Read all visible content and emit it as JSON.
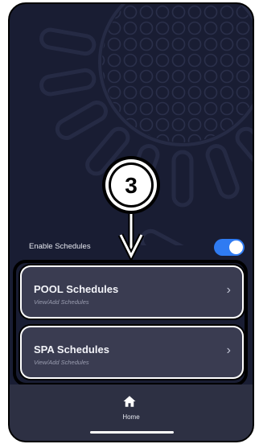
{
  "colors": {
    "background": "#191d33",
    "card": "#3a3c51",
    "bottom_bar": "#2d3043",
    "toggle_on": "#2f7bf2"
  },
  "enable_schedules": {
    "label": "Enable Schedules",
    "enabled": true
  },
  "schedules": [
    {
      "title": "POOL Schedules",
      "subtitle": "View/Add Schedules"
    },
    {
      "title": "SPA Schedules",
      "subtitle": "View/Add Schedules"
    }
  ],
  "callout": {
    "number": "3"
  },
  "bottom_nav": {
    "home_label": "Home",
    "home_icon": "home-icon"
  }
}
